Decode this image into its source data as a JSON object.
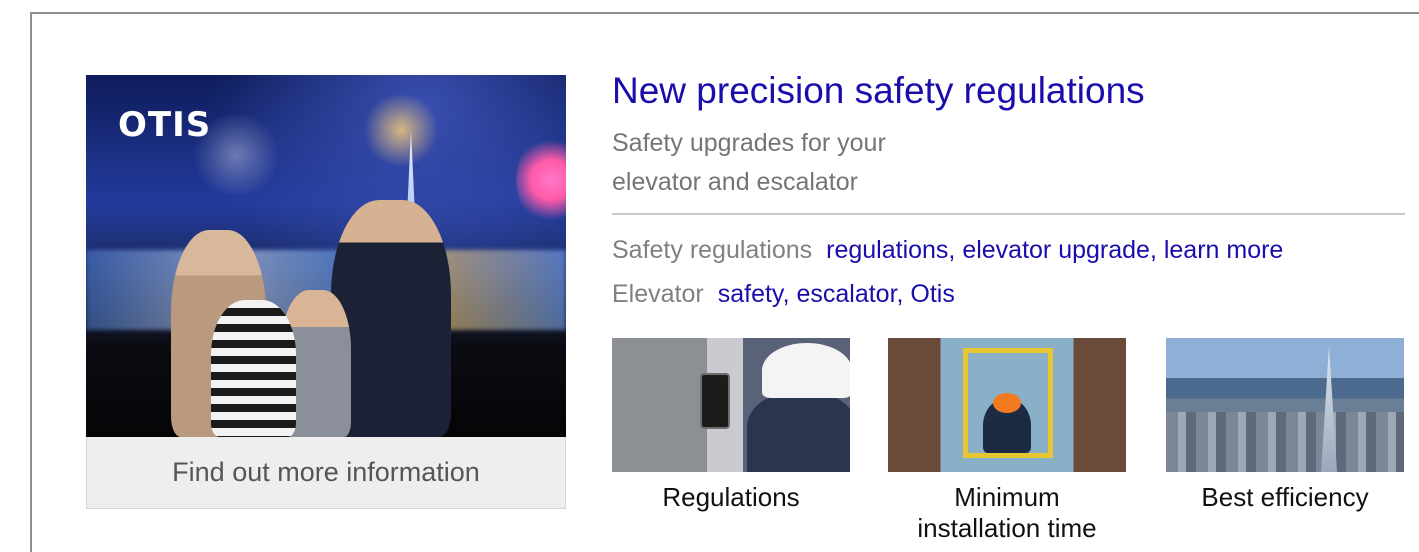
{
  "hero": {
    "logo_text": "OTIS",
    "button_label": "Find out more information"
  },
  "ad": {
    "headline": "New precision safety regulations",
    "description_line1": "Safety upgrades for your",
    "description_line2": "elevator and escalator"
  },
  "sitelinks": [
    {
      "label": "Safety regulations",
      "links": "regulations, elevator upgrade, learn more"
    },
    {
      "label": "Elevator",
      "links": "safety, escalator, Otis"
    }
  ],
  "gallery": [
    {
      "caption": "Regulations"
    },
    {
      "caption_line1": "Minimum",
      "caption_line2": "installation time"
    },
    {
      "caption": "Best efficiency"
    }
  ],
  "colors": {
    "link": "#1a0dab",
    "muted_text": "#757575",
    "button_bg": "#eeeeee"
  }
}
